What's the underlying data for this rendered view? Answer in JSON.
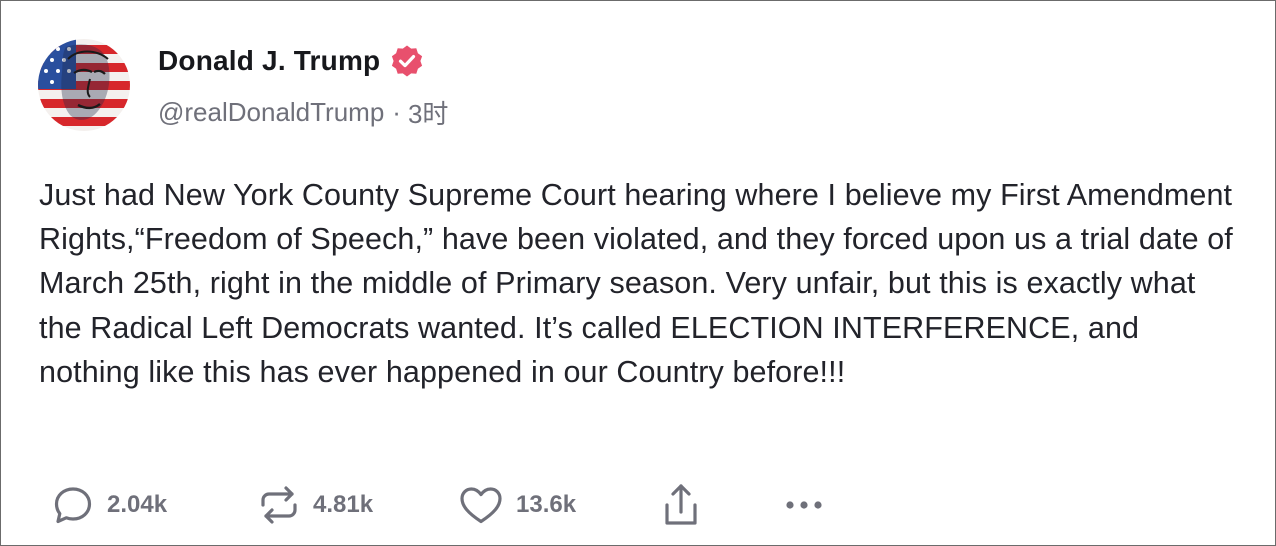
{
  "post": {
    "author": {
      "display_name": "Donald J. Trump",
      "handle": "@realDonaldTrump",
      "separator": "·",
      "time": "3时",
      "verified_color": "#e8506d"
    },
    "text": "Just had New York County Supreme Court hearing where I believe my First Amendment Rights,“Freedom of Speech,” have been violated, and they forced upon us a trial date of March 25th, right in the middle of Primary season. Very unfair, but this is exactly what the Radical Left Democrats wanted. It’s called ELECTION INTERFERENCE, and nothing like this has ever happened in our Country before!!!",
    "actions": {
      "reply": {
        "icon": "reply-icon",
        "count": "2.04k"
      },
      "retruth": {
        "icon": "retruth-icon",
        "count": "4.81k"
      },
      "like": {
        "icon": "heart-icon",
        "count": "13.6k"
      },
      "share": {
        "icon": "share-icon"
      },
      "more": {
        "icon": "more-icon"
      }
    }
  }
}
